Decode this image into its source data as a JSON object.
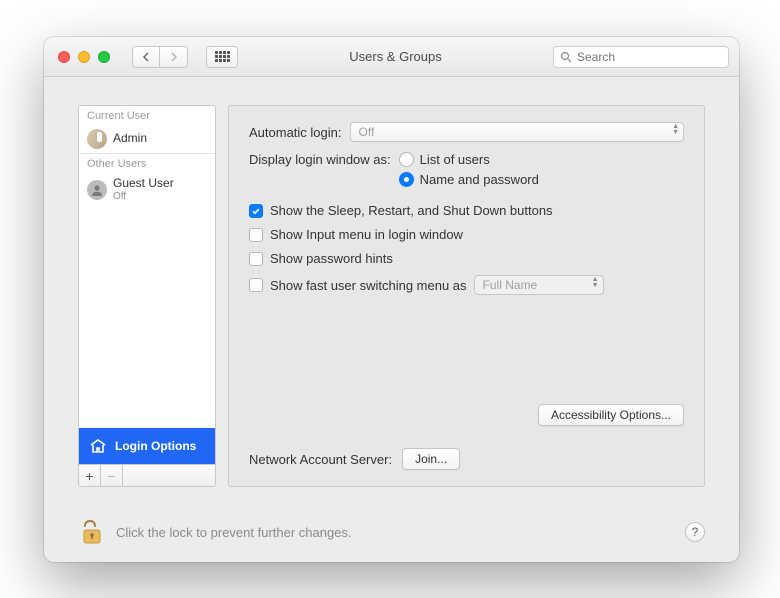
{
  "window": {
    "title": "Users & Groups"
  },
  "search": {
    "placeholder": "Search"
  },
  "sidebar": {
    "current_label": "Current User",
    "other_label": "Other Users",
    "current_user": {
      "name": "Admin",
      "sub": ""
    },
    "other_user": {
      "name": "Guest User",
      "sub": "Off"
    },
    "login_options_label": "Login Options"
  },
  "main": {
    "automatic_login_label": "Automatic login:",
    "automatic_login_value": "Off",
    "display_window_label": "Display login window as:",
    "radio_list": "List of users",
    "radio_namepass": "Name and password",
    "chk_sleep": "Show the Sleep, Restart, and Shut Down buttons",
    "chk_input": "Show Input menu in login window",
    "chk_hints": "Show password hints",
    "chk_fastswitch": "Show fast user switching menu as",
    "fastswitch_value": "Full Name",
    "accessibility_btn": "Accessibility Options...",
    "network_label": "Network Account Server:",
    "join_btn": "Join..."
  },
  "footer": {
    "lock_text": "Click the lock to prevent further changes.",
    "help": "?"
  }
}
